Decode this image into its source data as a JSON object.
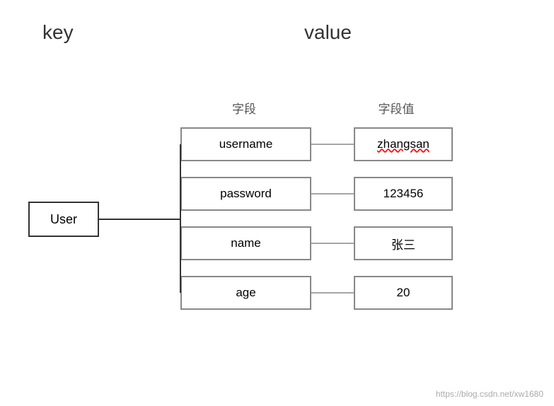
{
  "header": {
    "key_label": "key",
    "value_label": "value"
  },
  "diagram": {
    "col_field_label": "字段",
    "col_value_label": "字段值",
    "entity": "User",
    "fields": [
      {
        "name": "username",
        "value": "zhangsan",
        "red_underline": true
      },
      {
        "name": "password",
        "value": "123456",
        "red_underline": false
      },
      {
        "name": "name",
        "value": "张三",
        "red_underline": false
      },
      {
        "name": "age",
        "value": "20",
        "red_underline": false
      }
    ]
  },
  "watermark": "https://blog.csdn.net/xw1680"
}
